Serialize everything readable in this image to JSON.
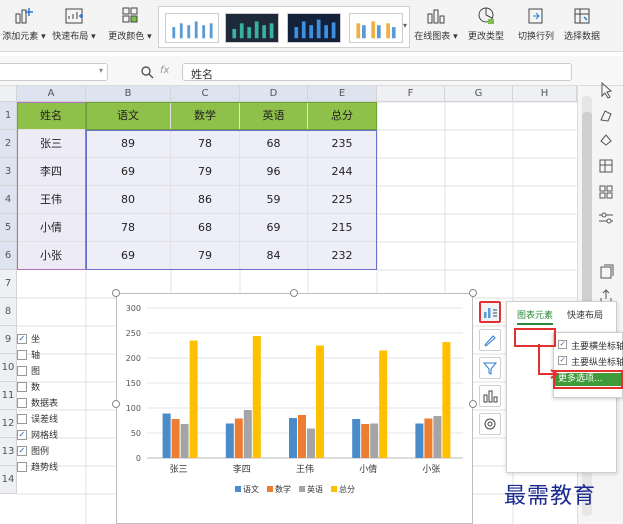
{
  "ribbon": {
    "buttons": [
      {
        "id": "add-element",
        "label": "添加元素",
        "has_menu": true
      },
      {
        "id": "quick-layout",
        "label": "快速布局",
        "has_menu": true
      },
      {
        "id": "change-color",
        "label": "更改颜色",
        "has_menu": true
      },
      {
        "id": "online-chart",
        "label": "在线图表",
        "has_menu": true
      },
      {
        "id": "change-type",
        "label": "更改类型"
      },
      {
        "id": "switch-row-col",
        "label": "切换行列"
      },
      {
        "id": "select-data",
        "label": "选择数据"
      }
    ]
  },
  "formula_bar": {
    "fx": "fx",
    "content": "姓名"
  },
  "columns": [
    "A",
    "B",
    "C",
    "D",
    "E",
    "F",
    "G",
    "H"
  ],
  "rows": [
    "1",
    "2",
    "3",
    "4",
    "5",
    "6",
    "7",
    "8",
    "9",
    "10",
    "11",
    "12",
    "13",
    "14"
  ],
  "table": {
    "headers": [
      "姓名",
      "语文",
      "数学",
      "英语",
      "总分"
    ],
    "rows": [
      [
        "张三",
        "89",
        "78",
        "68",
        "235"
      ],
      [
        "李四",
        "69",
        "79",
        "96",
        "244"
      ],
      [
        "王伟",
        "80",
        "86",
        "59",
        "225"
      ],
      [
        "小倩",
        "78",
        "68",
        "69",
        "215"
      ],
      [
        "小张",
        "69",
        "79",
        "84",
        "232"
      ]
    ]
  },
  "chart_data": {
    "type": "bar",
    "categories": [
      "张三",
      "李四",
      "王伟",
      "小倩",
      "小张"
    ],
    "series": [
      {
        "name": "语文",
        "values": [
          89,
          69,
          80,
          78,
          69
        ],
        "color": "#4a8cc9"
      },
      {
        "name": "数学",
        "values": [
          78,
          79,
          86,
          68,
          79
        ],
        "color": "#ed7d31"
      },
      {
        "name": "英语",
        "values": [
          68,
          96,
          59,
          69,
          84
        ],
        "color": "#a5a5a5"
      },
      {
        "name": "总分",
        "values": [
          235,
          244,
          225,
          215,
          232
        ],
        "color": "#ffc000"
      }
    ],
    "yticks": [
      "0",
      "50",
      "100",
      "150",
      "200",
      "250",
      "300"
    ],
    "ylim": [
      0,
      300
    ],
    "grid": true,
    "legend": "bottom"
  },
  "chart_tools": [
    "chart-elements",
    "chart-style",
    "chart-filter",
    "chart-online",
    "chart-settings"
  ],
  "elements_panel": {
    "tabs": [
      "图表元素",
      "快速布局"
    ],
    "items": [
      {
        "label": "坐",
        "checked": true
      },
      {
        "label": "轴",
        "checked": false
      },
      {
        "label": "图",
        "checked": false
      },
      {
        "label": "数",
        "checked": false
      },
      {
        "label": "数据表",
        "checked": false
      },
      {
        "label": "误差线",
        "checked": false
      },
      {
        "label": "网格线",
        "checked": true
      },
      {
        "label": "图例",
        "checked": true
      },
      {
        "label": "趋势线",
        "checked": false
      }
    ],
    "submenu": [
      {
        "label": "主要横坐标轴",
        "checked": true
      },
      {
        "label": "主要纵坐标轴",
        "checked": true
      }
    ],
    "more_options": "更多选项..."
  },
  "watermark": "最需教育"
}
